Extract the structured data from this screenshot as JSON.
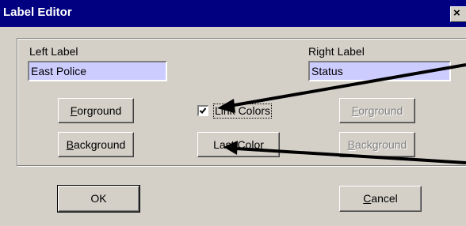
{
  "window": {
    "title": "Label Editor",
    "close_icon": "close-icon",
    "close_glyph": "×"
  },
  "left": {
    "label": "Left Label",
    "value": "East Police",
    "foreground_label": "Forground",
    "background_label": "Background"
  },
  "right": {
    "label": "Right Label",
    "value": "Status",
    "foreground_label": "Forground",
    "background_label": "Background"
  },
  "middle": {
    "link_colors_label": "Link Colors",
    "link_colors_checked": true,
    "checkmark_glyph": "✓",
    "last_color_label": "Last Color"
  },
  "footer": {
    "ok_label": "OK",
    "cancel_label": "Cancel"
  },
  "colors": {
    "title_bar": "#000080",
    "dialog_face": "#d4d0c8",
    "text_field": "#ccccff",
    "annotation_arrow": "#000000"
  }
}
